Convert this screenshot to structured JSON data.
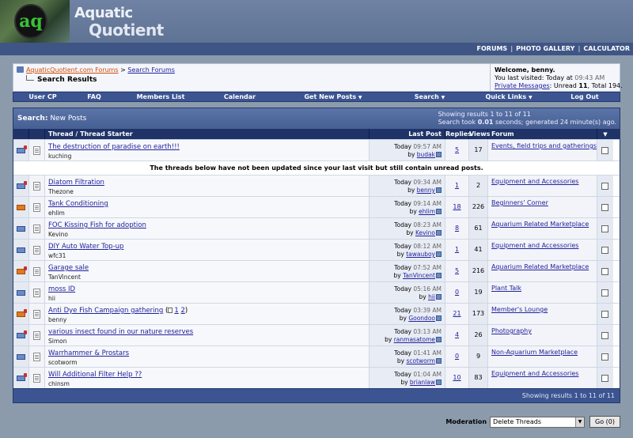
{
  "header": {
    "logo_badge_letters": "aq",
    "wordmark_line1": "Aquatic",
    "wordmark_line2": "Quotient"
  },
  "top_nav": [
    "FORUMS",
    "PHOTO GALLERY",
    "CALCULATOR"
  ],
  "breadcrumb": {
    "home": "AquaticQuotient.com Forums",
    "separator": ">",
    "parent": "Search Forums",
    "current": "Search Results"
  },
  "welcome": {
    "greeting": "Welcome, benny.",
    "last_visited_label": "You last visited: Today at",
    "last_visited_time": "09:43 AM",
    "pm_label": "Private Messages",
    "pm_stats_prefix": ": Unread",
    "pm_unread": "11",
    "pm_total_text": ", Total 194."
  },
  "menu": [
    "User CP",
    "FAQ",
    "Members List",
    "Calendar",
    "Get New Posts",
    "Search",
    "Quick Links",
    "Log Out"
  ],
  "results": {
    "title_bold": "Search:",
    "title_sub": "New Posts",
    "info_line1": "Showing results 1 to 11 of 11",
    "info_line2_prefix": "Search took",
    "search_time": "0.01",
    "info_line2_suffix": "seconds; generated 24 minute(s) ago.",
    "columns": {
      "title": "Thread / Thread Starter",
      "last_post": "Last Post",
      "replies": "Replies",
      "views": "Views",
      "forum": "Forum"
    },
    "notice": "The threads below have not been updated since your last visit but still contain unread posts.",
    "footer": "Showing results 1 to 11 of 11",
    "threads": [
      {
        "title": "The destruction of paradise on earth!!!",
        "starter": "kuching",
        "day": "Today",
        "time": "09:57 AM",
        "by": "budak",
        "replies": "5",
        "views": "17",
        "forum": "Events, field trips and gatherings",
        "icon": "env-user"
      },
      {
        "title": "Diatom Filtration",
        "starter": "Thezone",
        "day": "Today",
        "time": "09:34 AM",
        "by": "benny",
        "replies": "1",
        "views": "2",
        "forum": "Equipment and Accessories",
        "icon": "env-user"
      },
      {
        "title": "Tank Conditioning",
        "starter": "ehlim",
        "day": "Today",
        "time": "09:14 AM",
        "by": "ehlim",
        "replies": "18",
        "views": "226",
        "forum": "Beginners' Corner",
        "icon": "env-hot"
      },
      {
        "title": "FOC Kissing Fish for adoption",
        "starter": "Kevino",
        "day": "Today",
        "time": "08:23 AM",
        "by": "Kevino",
        "replies": "8",
        "views": "61",
        "forum": "Aquarium Related Marketplace",
        "icon": "env"
      },
      {
        "title": "DIY Auto Water Top-up",
        "starter": "wfc31",
        "day": "Today",
        "time": "08:12 AM",
        "by": "tawauboy",
        "replies": "1",
        "views": "41",
        "forum": "Equipment and Accessories",
        "icon": "env"
      },
      {
        "title": "Garage sale",
        "starter": "TanVincent",
        "day": "Today",
        "time": "07:52 AM",
        "by": "TanVincent",
        "replies": "5",
        "views": "216",
        "forum": "Aquarium Related Marketplace",
        "icon": "env-hot-user"
      },
      {
        "title": "moss ID",
        "starter": "hii",
        "day": "Today",
        "time": "05:16 AM",
        "by": "hii",
        "replies": "0",
        "views": "19",
        "forum": "Plant Talk",
        "icon": "env"
      },
      {
        "title": "Anti Dye Fish Campaign gathering",
        "starter": "benny",
        "day": "Today",
        "time": "03:39 AM",
        "by": "Goondoo",
        "replies": "21",
        "views": "173",
        "forum": "Member's Lounge",
        "icon": "env-hot-user",
        "pages": [
          "1",
          "2"
        ]
      },
      {
        "title": "various insect found in our nature reserves",
        "starter": "Simon",
        "day": "Today",
        "time": "03:13 AM",
        "by": "ranmasatome",
        "replies": "4",
        "views": "26",
        "forum": "Photography",
        "icon": "env-user"
      },
      {
        "title": "Warrhammer & Prostars",
        "starter": "scotworm",
        "day": "Today",
        "time": "01:41 AM",
        "by": "scotworm",
        "replies": "0",
        "views": "9",
        "forum": "Non-Aquarium Marketplace",
        "icon": "env"
      },
      {
        "title": "Will Additional Filter Help ??",
        "starter": "chinsm",
        "day": "Today",
        "time": "01:04 AM",
        "by": "brianlaw",
        "replies": "10",
        "views": "83",
        "forum": "Equipment and Accessories",
        "icon": "env-user"
      }
    ]
  },
  "moderation": {
    "label": "Moderation",
    "selected": "Delete Threads",
    "go": "Go (0)"
  },
  "colors": {
    "page_bg": "#8b9bab",
    "header_bg": "#6f82a4",
    "nav_bar": "#3f5585",
    "table_head": "#1f3368",
    "link": "#22229c"
  }
}
